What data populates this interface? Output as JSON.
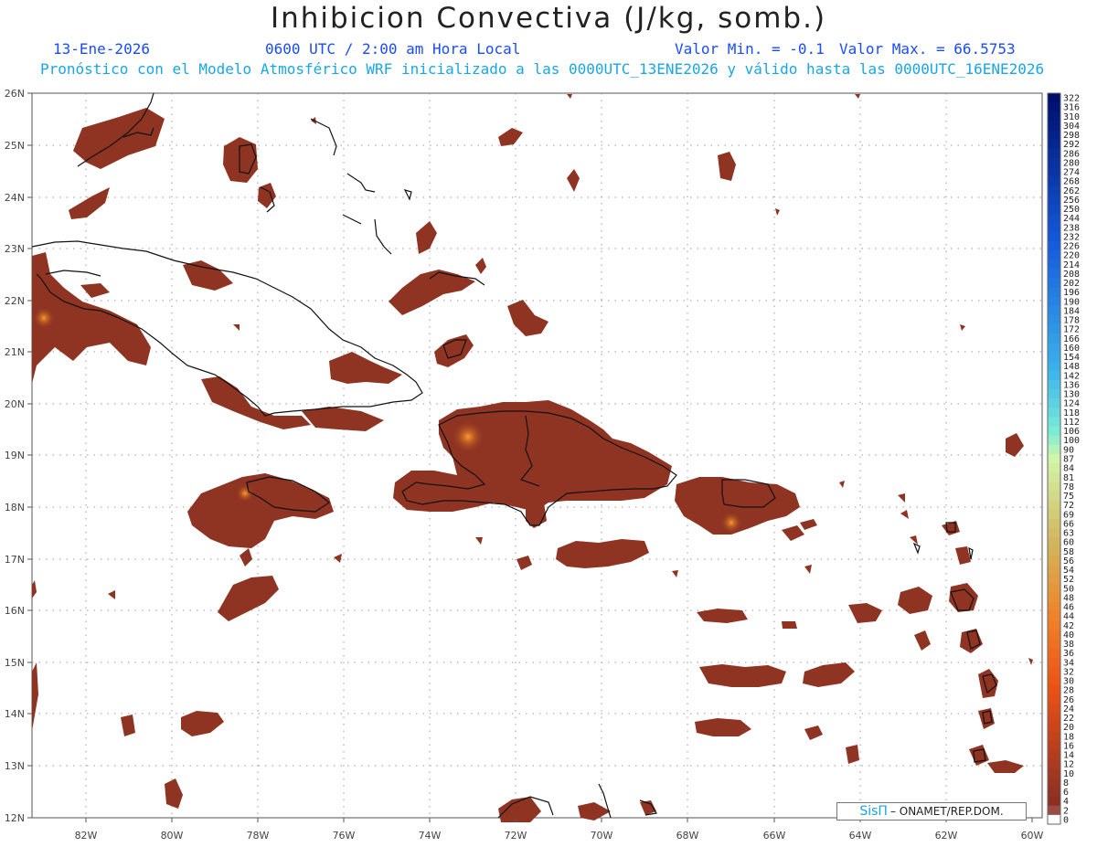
{
  "header": {
    "title": "Inhibicion Convectiva (J/kg, somb.)",
    "date": "13-Ene-2026",
    "time": "0600 UTC / 2:00 am Hora Local",
    "valor_min": "Valor Min. = -0.1",
    "valor_max": "Valor Max. = 66.5753",
    "forecast_note": "Pronóstico con el Modelo Atmosférico WRF inicializado a las 0000UTC_13ENE2026 y válido hasta las  0000UTC_16ENE2026"
  },
  "map": {
    "lat_labels": [
      "26N",
      "25N",
      "24N",
      "23N",
      "22N",
      "21N",
      "20N",
      "19N",
      "18N",
      "17N",
      "16N",
      "15N",
      "14N",
      "13N",
      "12N"
    ],
    "lon_labels": [
      "82W",
      "80W",
      "78W",
      "76W",
      "74W",
      "72W",
      "70W",
      "68W",
      "66W",
      "64W",
      "62W",
      "60W"
    ],
    "lat_range": [
      12,
      26
    ],
    "lon_range": [
      -83.2,
      -59.8
    ],
    "grid": true,
    "fill_color": "#8f3422",
    "coast_color": "#111111"
  },
  "colorbar": {
    "labels": [
      "322",
      "316",
      "310",
      "304",
      "298",
      "292",
      "286",
      "280",
      "274",
      "268",
      "262",
      "256",
      "250",
      "244",
      "238",
      "232",
      "226",
      "220",
      "214",
      "208",
      "202",
      "196",
      "190",
      "184",
      "178",
      "172",
      "166",
      "160",
      "154",
      "148",
      "142",
      "136",
      "130",
      "124",
      "118",
      "112",
      "106",
      "100",
      "90",
      "87",
      "84",
      "81",
      "78",
      "75",
      "72",
      "69",
      "66",
      "63",
      "60",
      "58",
      "56",
      "54",
      "52",
      "50",
      "48",
      "46",
      "44",
      "42",
      "40",
      "38",
      "36",
      "34",
      "32",
      "30",
      "28",
      "26",
      "24",
      "22",
      "20",
      "18",
      "16",
      "14",
      "12",
      "10",
      "8",
      "6",
      "4",
      "2",
      "0"
    ]
  },
  "badge": {
    "brand": "SisΠ",
    "text": "– ONAMET/REP.DOM."
  }
}
